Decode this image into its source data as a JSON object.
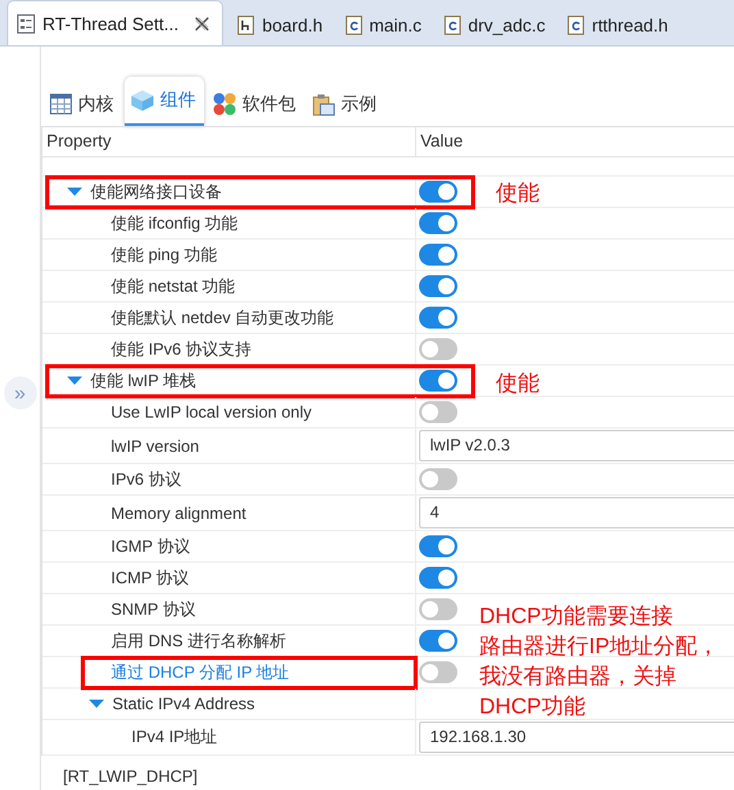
{
  "editor_tabs": [
    {
      "label": "RT-Thread Sett...",
      "kind": "settings",
      "selected": true,
      "closable": true
    },
    {
      "label": "board.h",
      "kind": "header",
      "selected": false,
      "closable": false
    },
    {
      "label": "main.c",
      "kind": "source",
      "selected": false,
      "closable": false
    },
    {
      "label": "drv_adc.c",
      "kind": "source",
      "selected": false,
      "closable": false
    },
    {
      "label": "rtthread.h",
      "kind": "source",
      "selected": false,
      "closable": false
    }
  ],
  "side_toggle": "»",
  "config_tabs": [
    {
      "label": "内核",
      "kind": "table",
      "selected": false
    },
    {
      "label": "组件",
      "kind": "cube",
      "selected": true
    },
    {
      "label": "软件包",
      "kind": "dots",
      "selected": false
    },
    {
      "label": "示例",
      "kind": "clipboard",
      "selected": false
    }
  ],
  "table": {
    "columns": [
      "Property",
      "Value"
    ],
    "rows": [
      {
        "label": "使能网络接口设备",
        "kind": "toggle",
        "on": true,
        "expanded": true,
        "highlighted": true,
        "selected": false,
        "children": [
          {
            "label": "使能 ifconfig 功能",
            "kind": "toggle",
            "on": true,
            "highlighted": false,
            "selected": false
          },
          {
            "label": "使能 ping 功能",
            "kind": "toggle",
            "on": true,
            "highlighted": false,
            "selected": false
          },
          {
            "label": "使能 netstat 功能",
            "kind": "toggle",
            "on": true,
            "highlighted": false,
            "selected": false
          },
          {
            "label": "使能默认 netdev 自动更改功能",
            "kind": "toggle",
            "on": true,
            "highlighted": false,
            "selected": false
          },
          {
            "label": "使能 IPv6 协议支持",
            "kind": "toggle",
            "on": false,
            "highlighted": false,
            "selected": false
          }
        ]
      },
      {
        "label": "使能 lwIP 堆栈",
        "kind": "toggle",
        "on": true,
        "expanded": true,
        "highlighted": true,
        "selected": false,
        "children": [
          {
            "label": "Use LwIP local version only",
            "kind": "toggle",
            "on": false,
            "highlighted": false,
            "selected": false
          },
          {
            "label": "lwIP version",
            "kind": "field",
            "value": "lwIP v2.0.3",
            "highlighted": false,
            "selected": false
          },
          {
            "label": "IPv6 协议",
            "kind": "toggle",
            "on": false,
            "highlighted": false,
            "selected": false
          },
          {
            "label": "Memory alignment",
            "kind": "field",
            "value": "4",
            "highlighted": false,
            "selected": false
          },
          {
            "label": "IGMP 协议",
            "kind": "toggle",
            "on": true,
            "highlighted": false,
            "selected": false
          },
          {
            "label": "ICMP 协议",
            "kind": "toggle",
            "on": true,
            "highlighted": false,
            "selected": false
          },
          {
            "label": "SNMP 协议",
            "kind": "toggle",
            "on": false,
            "highlighted": false,
            "selected": false
          },
          {
            "label": "启用 DNS 进行名称解析",
            "kind": "toggle",
            "on": true,
            "highlighted": false,
            "selected": false
          },
          {
            "label": "通过 DHCP 分配 IP 地址",
            "kind": "toggle",
            "on": false,
            "highlighted": true,
            "selected": true
          },
          {
            "label": "Static IPv4 Address",
            "kind": "group",
            "expanded": true,
            "highlighted": false,
            "selected": false,
            "children": [
              {
                "label": "IPv4 IP地址",
                "kind": "field",
                "value": "192.168.1.30",
                "highlighted": false,
                "selected": false
              }
            ]
          }
        ]
      }
    ]
  },
  "description": "[RT_LWIP_DHCP]",
  "annotations": [
    {
      "lines": [
        "使能"
      ]
    },
    {
      "lines": [
        "使能"
      ]
    },
    {
      "lines": [
        "DHCP功能需要连接",
        "路由器进行IP地址分配，",
        "我没有路由器，关掉",
        "DHCP功能"
      ]
    }
  ]
}
